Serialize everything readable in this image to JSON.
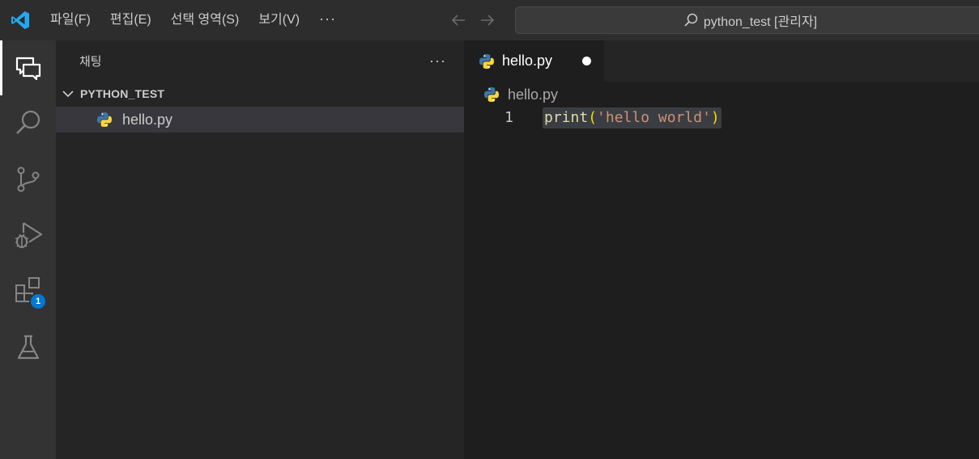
{
  "titlebar": {
    "menu": [
      "파일(F)",
      "편집(E)",
      "선택 영역(S)",
      "보기(V)"
    ],
    "more": "···",
    "command_center": "python_test [관리자]"
  },
  "activity_bar": {
    "items": [
      {
        "icon": "chat-icon",
        "active": true
      },
      {
        "icon": "search-icon"
      },
      {
        "icon": "source-control-icon"
      },
      {
        "icon": "run-debug-icon"
      },
      {
        "icon": "extensions-icon",
        "badge": "1"
      },
      {
        "icon": "testing-flask-icon"
      }
    ]
  },
  "sidebar": {
    "title": "채팅",
    "more": "···",
    "folder": "PYTHON_TEST",
    "files": [
      "hello.py"
    ]
  },
  "editor": {
    "tab": {
      "label": "hello.py",
      "modified": true
    },
    "breadcrumb": "hello.py",
    "lines": [
      {
        "number": "1",
        "tokens": {
          "fn": "print",
          "open": "(",
          "str": "'hello world'",
          "close": ")"
        }
      }
    ]
  },
  "colors": {
    "accent": "#0078d4",
    "vscode_logo": "#23a9f2",
    "python_blue": "#3b77a8",
    "python_yellow": "#ffd43b"
  }
}
